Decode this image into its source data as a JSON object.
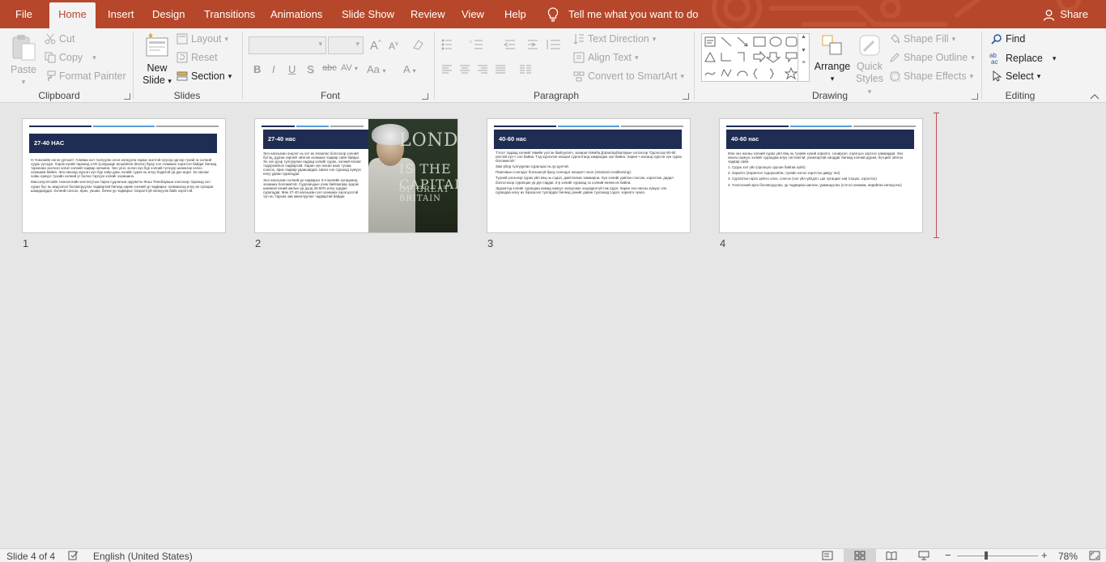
{
  "tabs": [
    {
      "label": "File",
      "active": false
    },
    {
      "label": "Home",
      "active": true
    },
    {
      "label": "Insert",
      "active": false
    },
    {
      "label": "Design",
      "active": false
    },
    {
      "label": "Transitions",
      "active": false
    },
    {
      "label": "Animations",
      "active": false
    },
    {
      "label": "Slide Show",
      "active": false
    },
    {
      "label": "Review",
      "active": false
    },
    {
      "label": "View",
      "active": false
    },
    {
      "label": "Help",
      "active": false
    }
  ],
  "tell_me": "Tell me what you want to do",
  "share": "Share",
  "colors": {
    "accent": "#b7472a",
    "ribbon_bg": "#f3f3f3",
    "slide_banner": "#1f2d53",
    "insert_line": "#c0504d"
  },
  "ribbon": {
    "clipboard": {
      "label": "Clipboard",
      "paste": "Paste",
      "cut": "Cut",
      "copy": "Copy",
      "format_painter": "Format Painter"
    },
    "slides": {
      "label": "Slides",
      "new_slide_1": "New",
      "new_slide_2": "Slide",
      "layout": "Layout",
      "reset": "Reset",
      "section": "Section"
    },
    "font": {
      "label": "Font",
      "bold": "B",
      "italic": "I",
      "underline": "U",
      "shadow": "S",
      "strike": "abc",
      "spacing": "AV",
      "case": "Aa",
      "color": "A",
      "grow": "A",
      "shrink": "A"
    },
    "paragraph": {
      "label": "Paragraph",
      "text_direction": "Text Direction",
      "align_text": "Align Text",
      "smartart": "Convert to SmartArt"
    },
    "drawing": {
      "label": "Drawing",
      "arrange": "Arrange",
      "quick_styles_1": "Quick",
      "quick_styles_2": "Styles",
      "shape_fill": "Shape Fill",
      "shape_outline": "Shape Outline",
      "shape_effects": "Shape Effects"
    },
    "editing": {
      "label": "Editing",
      "find": "Find",
      "replace": "Replace",
      "select": "Select"
    }
  },
  "slides": [
    {
      "number": "1",
      "title": "27-40 НАС",
      "body": [
        "Н.Чомскийн нэгэн уулзалт 'Аливаа хэл тоолуулж олон хөгжүүлж гараж эхэлтэй хүүхэд эдгээр тухай эх хэлний суурь үүсэдэг. Хэрэв хүний тархинд LAD (Language acquisition device) буюу хэл эзэмших хэрэгсэл байдаг бөгөөд тархинаа эзэлхэн эсвэл хэлний чадвар хөгжинө. Энэ үеэс эхлэн хүн бүр хэлний түлхүүр шинжээр хэлээ эзэмшиж байна. Энэ насанд хүрсэн хүн бүр хоёр дахь хэлийг сурах нь илүү бодитой үр дүн өгдөг. 16 насаас хойш хүмүүс тухайн хэлний үг болон тэргүүн хэлийг эзэмшинэ.",
        "Массачусетсийн технологийн институтын тархи судлалын эрдэмтэн Жош Тенебаумын хэлснээр тархинд хэл сурах бүс нь мэдээлэл боловсруулах чадвартай бөгөөд харин хэлний ур чадварыг эзэмшихэд илүү их хугацаа шаардагддаг. Хэлний сонсох, ярих, унших, бичих ур чадварыг тасралтгүй хөгжүүлж байх хэрэгтэй."
      ]
    },
    {
      "number": "2",
      "title": "27-40 нас",
      "body": [
        "Энэ насныхан онцлог нь хэт их ачаалал болсноор хэлний бүтэц, дүрэм зэргийг ойлгож эзэмших чадвар сайн байдаг. Эх хэл дээр тулгуурлан гадаад хэлийг сурах, хэлний ялгааг тодорхойлох чадвартай. Харин хүн насан ахих тусам, сонсох, ярих чадвар удааширдаг. Шинэ хэл сурахад хүмүүс илүү удаан суралцдаг.",
        "Энэ насныхан хэлний ур чадварыг 3-4 жилийн хугацаанд эзэмших боломжтой. Судлаачдын үзэж байгаагаар эрдэм шинжилгээний ажлын үр дүнд 30-50% илүү хурдан суралцдаг. Мөн 27-40 насныхан хэл эзэмших хэрэгцээтэй тул нь 'тархиа зөв ажиллуулах' чадвартай байдаг."
      ],
      "image_text": [
        "LONDON",
        "IS THE CAPITAL",
        "OF GREAT BRITAIN"
      ]
    },
    {
      "number": "3",
      "title": "40-60 нас",
      "body": [
        "'Гэгээ' гадаад хэлний төвийн үүсгэн байгуулагч, захирал Бямба Д.Баатарбаатарын хэлснээр 'Одоогоор 50-60 настай хүн ч хэл байна. Тэд хүрээлэн нөхцөл сургалтанд хамрагдах хүн байна. Харин ч насанд хүрсэн хүн сурах боломжтой.'",
        "Зам үйлд тулгуурлан суралцах нь үр дүнтэй.",
        "Павловын сонгодог болзошгүй буюу сонгодог нөхцөлт онол (classical conditioning):",
        "Түүний үзсэнээр сурах үйл явц нь сэдэл, давтлагаас хамаарна. Хүн хэлийг давтан сонсож, хэрэглэж, дадал болгосноор суралцах үр дүн гардаг. 2-р хэлийг сурахад эх хэлний нөлөө их байна.",
        "Эрдэмтэд хэлийг сурахдаа ахмад хүмүүс залуусаас хоцордоггүй гэж үздэг. Харин энэ насны хүмүүс хэл сурахдаа илүү их бэрхшээл тулгардаг бөгөөд үүнийг даван туулахад сэдэл, зорилго чухал."
      ]
    },
    {
      "number": "4",
      "title": "40-60 нас",
      "body": [
        "Мэн энэ насны хэлний сурах үйл явц нь тухайн хүний зорилго, сонирхол, хэрэгцээ зэргээс хамаардаг. Энэ насны хүмүүс хэлийг сурахдаа илүү системтэй, ухамсартай ханддаг бөгөөд хэлний дүрэм, бүтцийг ойлгох чадвар сайн.",
        "1. Суурь хэл үйл (оролцоо сурсан байгаа хүйл)",
        "2. Зорилго (Зорилгоо тодорхойлж, тухайн хэлээ хэрэглэх давуу тал)",
        "3. Сургалтын арга зүйгээ олох, сонсох (хэл үйл үйлдэл, цаг хугацааг зөв тооцох, хэрэглэх)",
        "4. Үнэлгээний арга боловсруулах, ур чадвараа шалгах, урамшуулах (сэтгэл ханамж, өөрийгөө хөгжүүлэх)"
      ]
    }
  ],
  "status": {
    "slide_counter": "Slide 4 of 4",
    "language": "English (United States)",
    "zoom": "78%",
    "zoom_minus": "−",
    "zoom_plus": "+"
  }
}
